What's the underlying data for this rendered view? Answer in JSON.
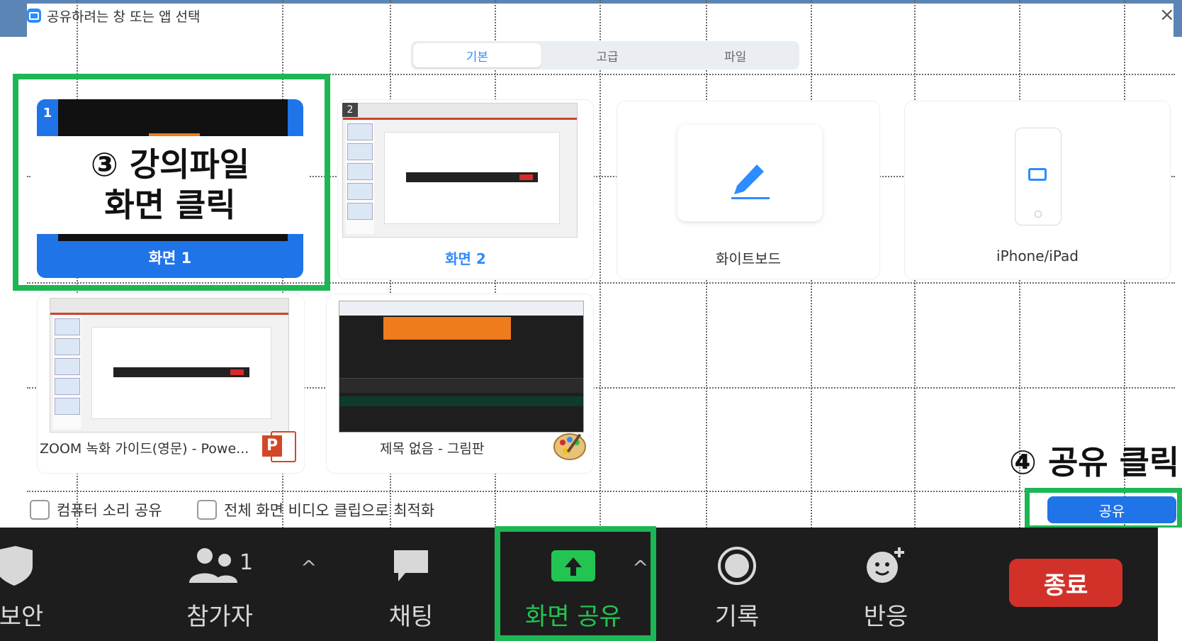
{
  "window": {
    "title": "공유하려는 창 또는 앱 선택",
    "close": "×"
  },
  "tabs": [
    {
      "label": "기본",
      "active": true
    },
    {
      "label": "고급",
      "active": false
    },
    {
      "label": "파일",
      "active": false
    }
  ],
  "sources": {
    "screen1": {
      "label": "화면 1",
      "badge": "1",
      "selected": true
    },
    "screen2": {
      "label": "화면 2",
      "badge": "2"
    },
    "whiteboard": {
      "label": "화이트보드",
      "icon": "pen-icon"
    },
    "iphone": {
      "label": "iPhone/iPad",
      "icon": "airplay-icon"
    },
    "ppt": {
      "label": "ZOOM 녹화 가이드(영문) - Powe...",
      "badge": "P"
    },
    "paint": {
      "label": "제목 없음 - 그림판"
    }
  },
  "options": {
    "share_sound": "컴퓨터 소리 공유",
    "optimize_video": "전체 화면 비디오 클립으로 최적화"
  },
  "share_button": "공유",
  "annotations": {
    "step3_line1": "③ 강의파일",
    "step3_line2": "화면 클릭",
    "step4": "④ 공유 클릭"
  },
  "toolbar": {
    "security": "보안",
    "participants": "참가자",
    "participant_count": "1",
    "chat": "채팅",
    "share_screen": "화면 공유",
    "record": "기록",
    "reactions": "반응",
    "end": "종료",
    "caret": "^"
  },
  "colors": {
    "accent": "#1f74e8",
    "callout_green": "#1db654",
    "end_red": "#d2312a",
    "share_green": "#23c552"
  }
}
